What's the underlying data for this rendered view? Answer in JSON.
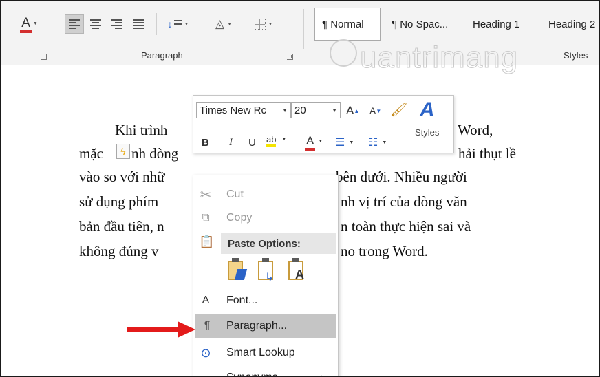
{
  "ribbon": {
    "paragraph_label": "Paragraph",
    "styles_label": "Styles",
    "styles": [
      "¶ Normal",
      "¶ No Spac...",
      "Heading 1",
      "Heading 2"
    ],
    "font_color": "#d32f2f"
  },
  "document": {
    "lines": [
      "Khi trình",
      "Word,",
      "mặc",
      "nh dòng",
      "hải thụt lề",
      "vào so với nhữ",
      "bên dưới. Nhiều người",
      "sử  dụng phím",
      "nh vị trí của dòng văn",
      "bản đầu tiên, n",
      "n toàn thực hiện sai và",
      "không đúng v",
      "no trong Word."
    ]
  },
  "watermark": {
    "text": "uantrimang"
  },
  "mini_toolbar": {
    "font_name": "Times New Rc",
    "font_size": "20",
    "grow_font": "A",
    "shrink_font": "A",
    "bold": "B",
    "italic": "I",
    "underline": "U",
    "highlight": "ab",
    "font_color": "A",
    "styles_label": "Styles",
    "accent_color": "#d32f2f",
    "highlight_color": "#f5e400"
  },
  "context_menu": {
    "items": [
      {
        "label": "Cut",
        "icon": "scissors-icon",
        "disabled": true
      },
      {
        "label": "Copy",
        "icon": "copy-icon",
        "disabled": true
      },
      {
        "label": "Paste Options:",
        "icon": "clipboard-icon"
      },
      {
        "label": "Font...",
        "icon": "font-icon"
      },
      {
        "label": "Paragraph...",
        "icon": "paragraph-icon",
        "highlighted": true
      },
      {
        "label": "Smart Lookup",
        "icon": "lookup-icon"
      },
      {
        "label": "Synonyms",
        "icon": "none",
        "submenu": true
      }
    ]
  },
  "annotation": {
    "arrow_color": "#e31b1b"
  }
}
